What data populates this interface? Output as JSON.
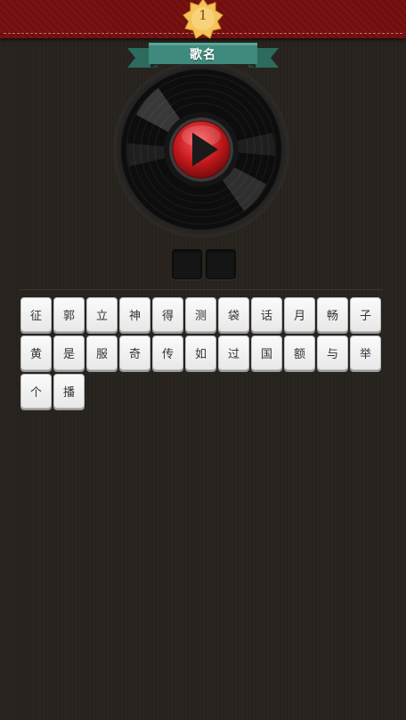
{
  "level": {
    "number": "1"
  },
  "song_title_banner": {
    "label": "歌名"
  },
  "answer": {
    "slots": [
      "",
      ""
    ]
  },
  "characters": [
    "征",
    "郭",
    "立",
    "神",
    "得",
    "测",
    "袋",
    "话",
    "月",
    "畅",
    "子",
    "黄",
    "是",
    "服",
    "奇",
    "传",
    "如",
    "过",
    "国",
    "额",
    "与",
    "举",
    "个",
    "播"
  ],
  "icons": {
    "play": "play-icon",
    "badge": "star-badge-icon"
  },
  "colors": {
    "top_bar": "#7a1212",
    "ribbon": "#3f8a7c",
    "play_button": "#c3191d",
    "background": "#2a2521"
  }
}
